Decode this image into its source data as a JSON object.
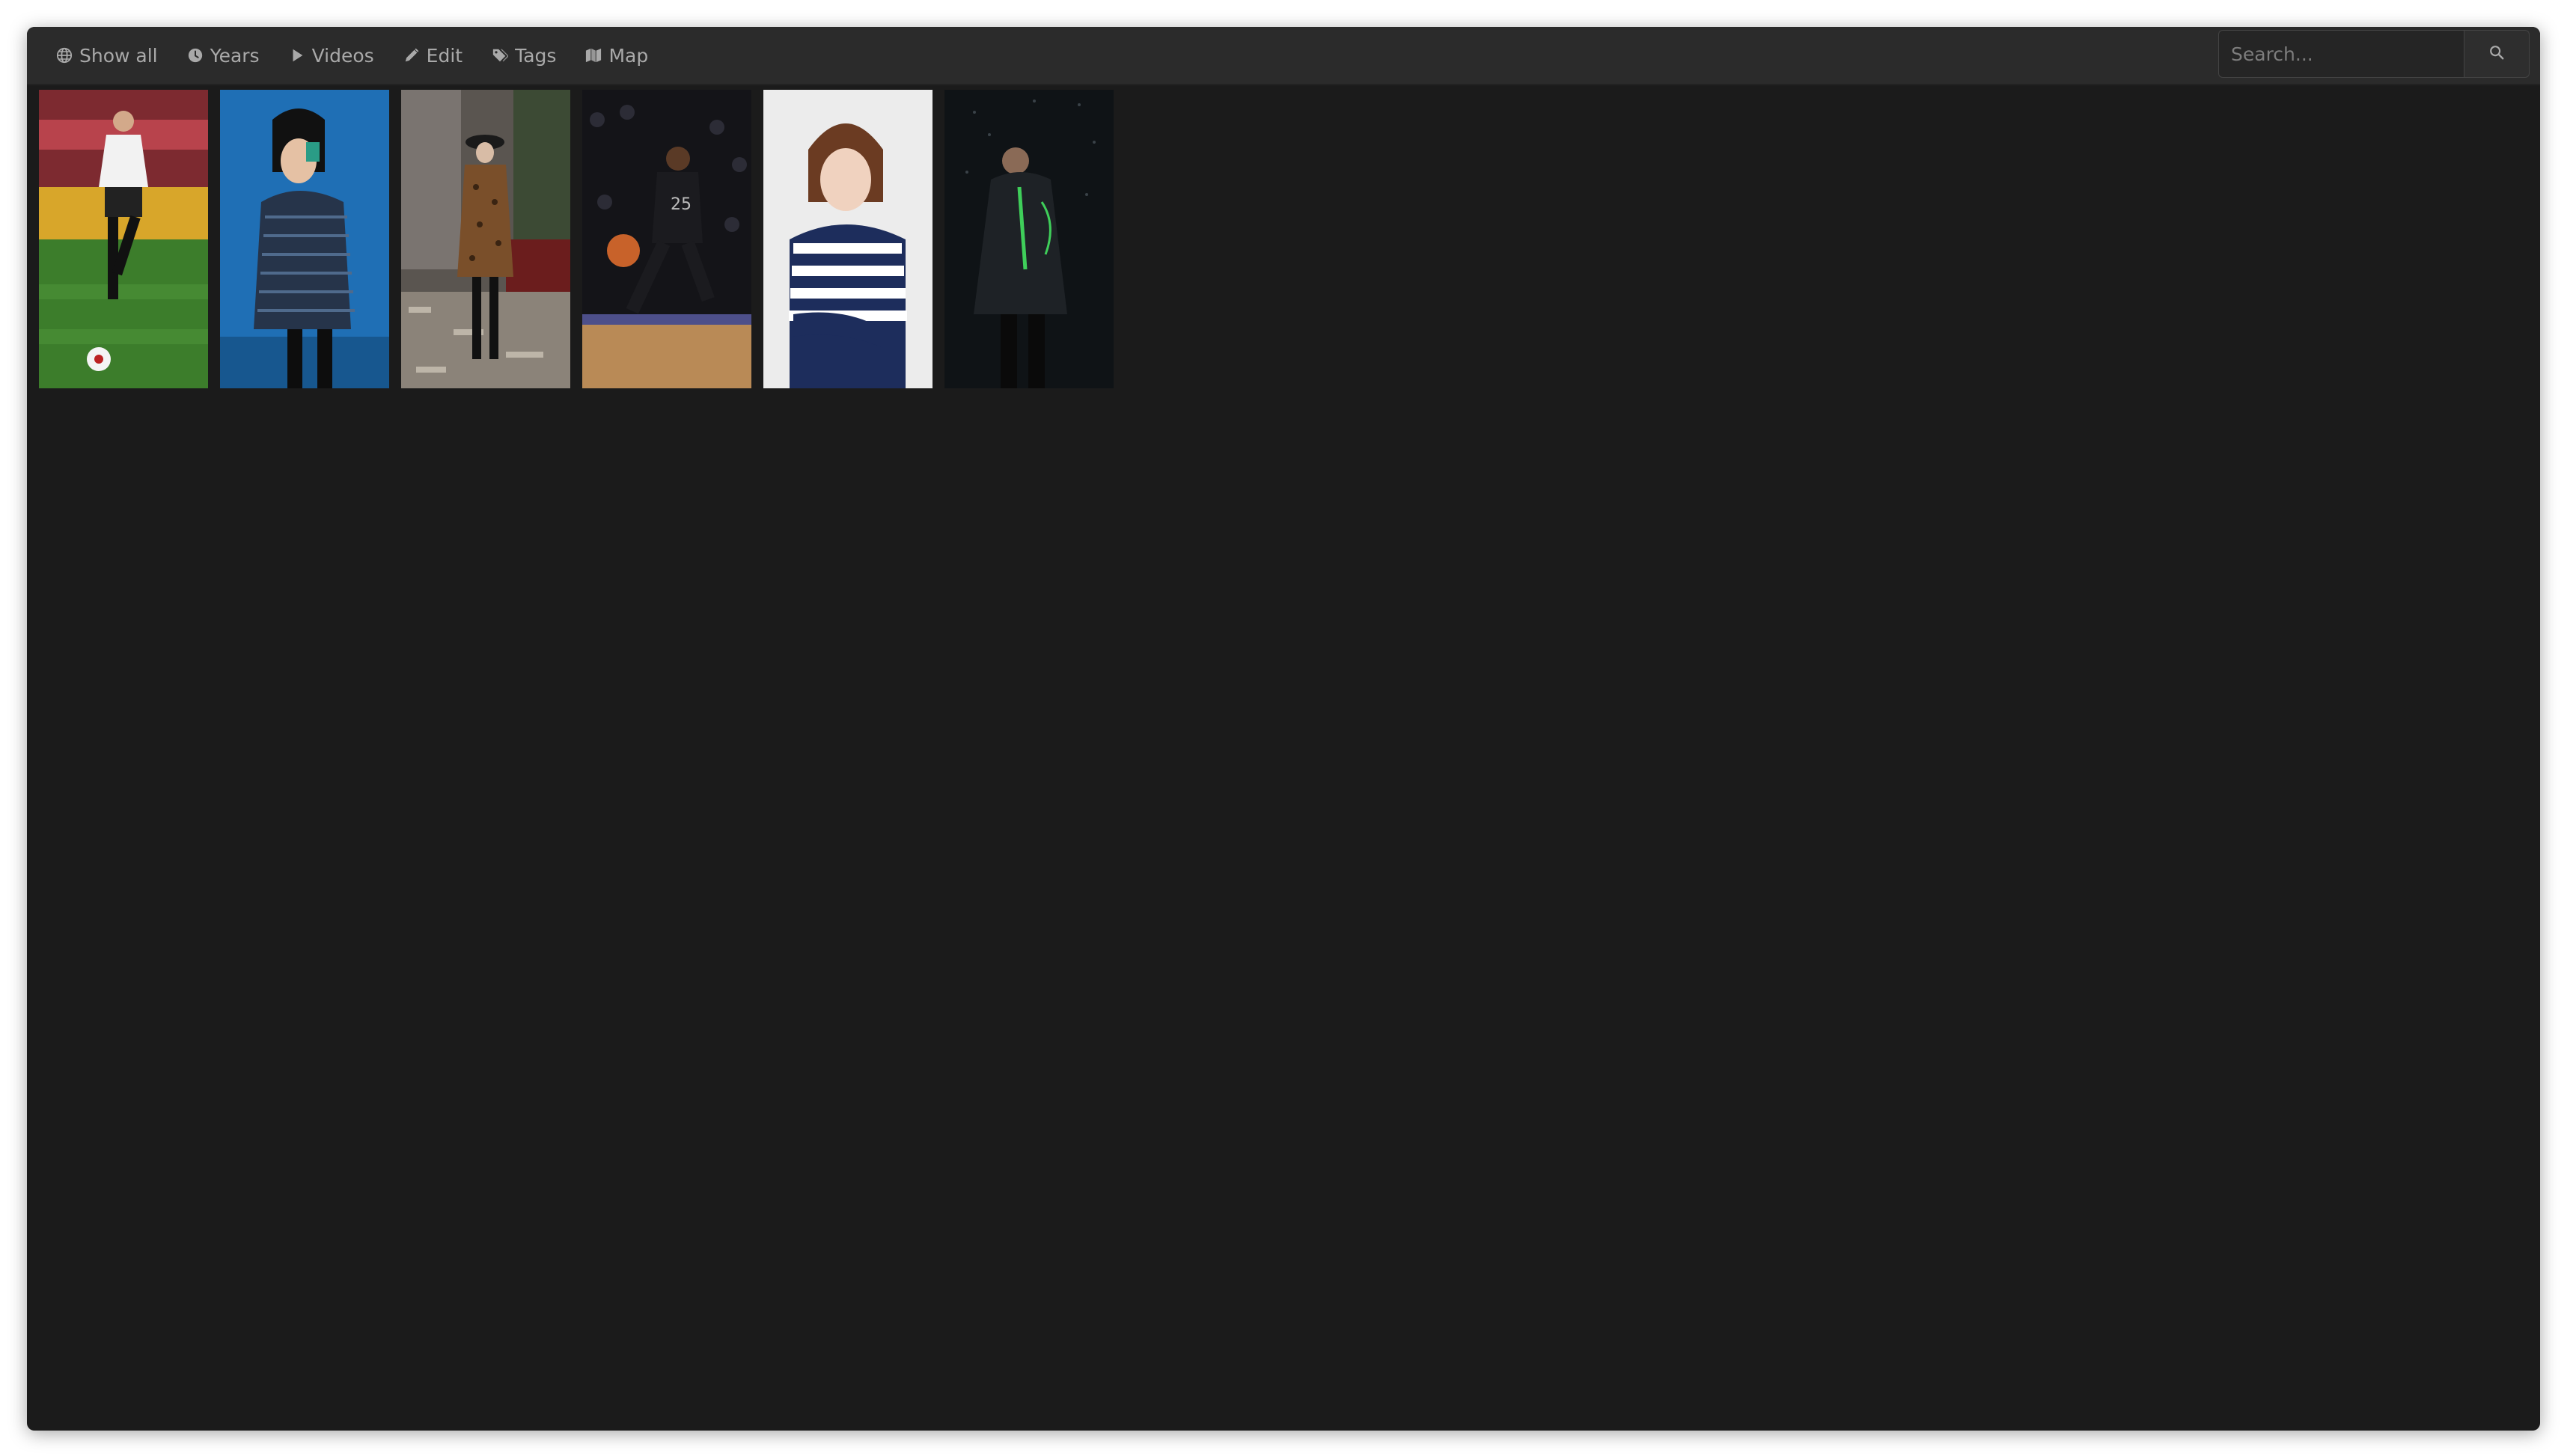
{
  "nav": {
    "items": [
      {
        "label": "Show all",
        "icon": "globe-icon"
      },
      {
        "label": "Years",
        "icon": "clock-icon"
      },
      {
        "label": "Videos",
        "icon": "play-icon"
      },
      {
        "label": "Edit",
        "icon": "pencil-icon"
      },
      {
        "label": "Tags",
        "icon": "tags-icon"
      },
      {
        "label": "Map",
        "icon": "map-icon"
      }
    ]
  },
  "search": {
    "placeholder": "Search...",
    "icon": "search-icon"
  },
  "gallery": {
    "photos": [
      {
        "subject": "soccer player",
        "bg": "#3a7a2a"
      },
      {
        "subject": "woman in striped sweater on blue",
        "bg": "#1f6fb5"
      },
      {
        "subject": "model in leopard coat",
        "bg": "#4a4540"
      },
      {
        "subject": "basketball player",
        "bg": "#141418"
      },
      {
        "subject": "woman in striped top",
        "bg": "#ececec"
      },
      {
        "subject": "man in dark jacket in rain",
        "bg": "#0f1316"
      }
    ]
  },
  "colors": {
    "background": "#1b1b1b",
    "navbar": "#2b2b2b",
    "nav_text": "#a9a9a9"
  }
}
